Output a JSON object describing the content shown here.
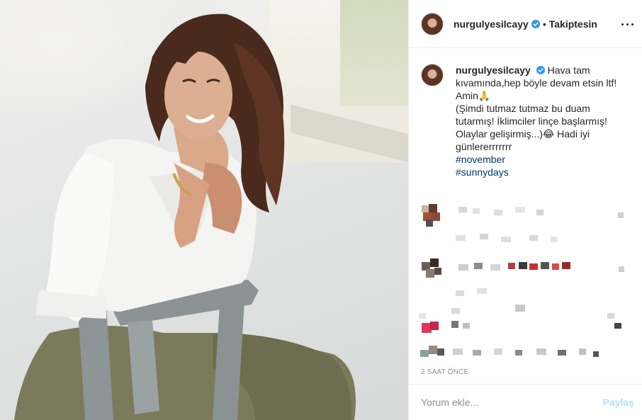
{
  "post": {
    "photo_alt": "",
    "icon": "photo"
  },
  "header": {
    "username": "nurgulyesilcayy",
    "separator": "•",
    "follow_label": "Takiptesin",
    "more_icon": "more-horizontal-icon",
    "verified_icon": "verified-badge-icon"
  },
  "caption": {
    "username": "nurgulyesilcayy",
    "lines": [
      "Hava tam",
      "kıvamında,hep böyle devam etsin ltf!",
      "Amin🙏",
      "(Şimdi tutmaz tutmaz bu duam",
      "tutarmış! İklimciler linçe başlarmış!",
      "Olaylar gelişirmiş...)😂 Hadi iyi",
      "günlererrrrrrr"
    ],
    "hashtags": [
      "#november",
      "#sunnydays"
    ]
  },
  "meta": {
    "time": "2 SAAT ÖNCE"
  },
  "comment_box": {
    "placeholder": "Yorum ekle...",
    "share_label": "Paylaş"
  },
  "colors": {
    "link": "#003569",
    "verified": "#3897f0",
    "share_disabled": "#b2dffc",
    "muted": "#8e8e8e"
  }
}
